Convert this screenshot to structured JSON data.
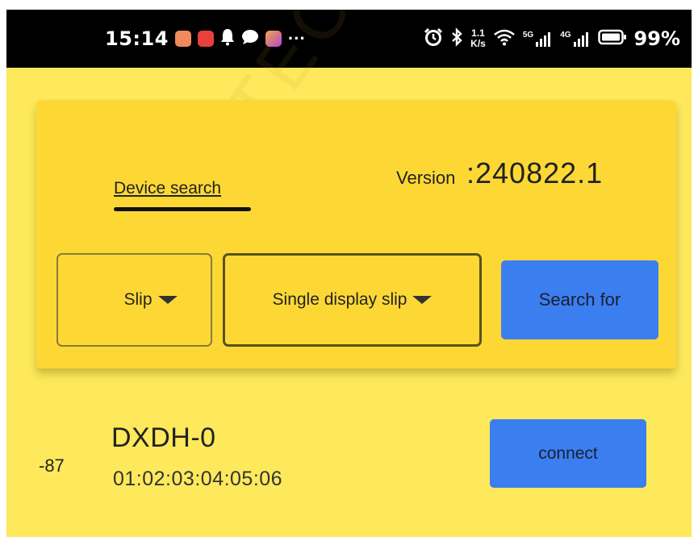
{
  "status_bar": {
    "time": "15:14",
    "more": "···",
    "speed_value": "1.1",
    "speed_unit": "K/s",
    "net1": "5G",
    "net2": "4G",
    "battery_pct": "99%",
    "notification_icons": [
      "browser-icon",
      "app-icon",
      "bell-icon",
      "chat-icon",
      "media-icon"
    ],
    "system_icons": [
      "alarm-icon",
      "bluetooth-icon",
      "wifi-icon",
      "signal-icon",
      "signal-icon",
      "battery-icon"
    ]
  },
  "header": {
    "tab_label": "Device search",
    "version_label": "Version",
    "version_value": ":240822.1"
  },
  "filters": {
    "type_value": "Slip",
    "mode_value": "Single display slip",
    "search_label": "Search for"
  },
  "devices": [
    {
      "rssi": "-87",
      "name": "DXDH-0",
      "mac": "01:02:03:04:05:06",
      "connect_label": "connect"
    }
  ],
  "watermark": "ZAX TECH",
  "colors": {
    "background": "#fde95b",
    "card": "#fdd835",
    "button": "#3b7ef0",
    "status_bar": "#000000"
  }
}
